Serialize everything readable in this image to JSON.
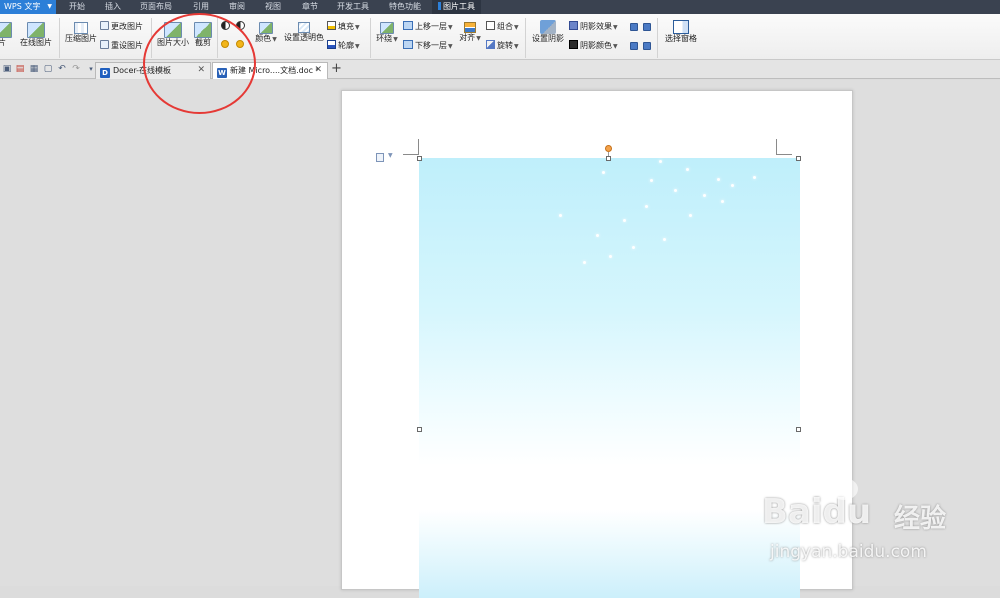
{
  "menubar": {
    "app_name": "WPS 文字",
    "items": [
      "开始",
      "插入",
      "页面布局",
      "引用",
      "审阅",
      "视图",
      "章节",
      "开发工具",
      "特色功能"
    ],
    "active_item": "图片工具"
  },
  "ribbon": {
    "insert_pic_partial": "片",
    "online_pic": "在线图片",
    "compress_pic": "压缩图片",
    "change_pic": "更改图片",
    "reset_pic": "重设图片",
    "pic_size": "图片大小",
    "crop": "截剪",
    "color": "颜色",
    "set_transparent": "设置透明色",
    "fill": "填充",
    "outline": "轮廓",
    "wrap": "环绕",
    "bring_forward": "上移一层",
    "send_backward": "下移一层",
    "align": "对齐",
    "group": "组合",
    "rotate": "旋转",
    "set_shadow": "设置阴影",
    "shadow_effect": "阴影效果",
    "shadow_color": "阴影颜色",
    "selection_pane": "选择窗格"
  },
  "tabs": [
    {
      "label": "Docer-在线模板",
      "icon_name": "docer-icon",
      "icon_color": "#1f5fbf"
    },
    {
      "label": "新建 Micro....文档.doc *",
      "icon_name": "word-doc-icon",
      "icon_color": "#2a62b8"
    }
  ],
  "watermark": {
    "brand": "Baidu",
    "brand_suffix": "经验",
    "url": "jingyan.baidu.com"
  },
  "colors": {
    "menubar_bg": "#3a4250",
    "app_button_bg": "#2c7fd8",
    "annotation_circle": "#e53935",
    "image_top": "#bfeffb"
  }
}
